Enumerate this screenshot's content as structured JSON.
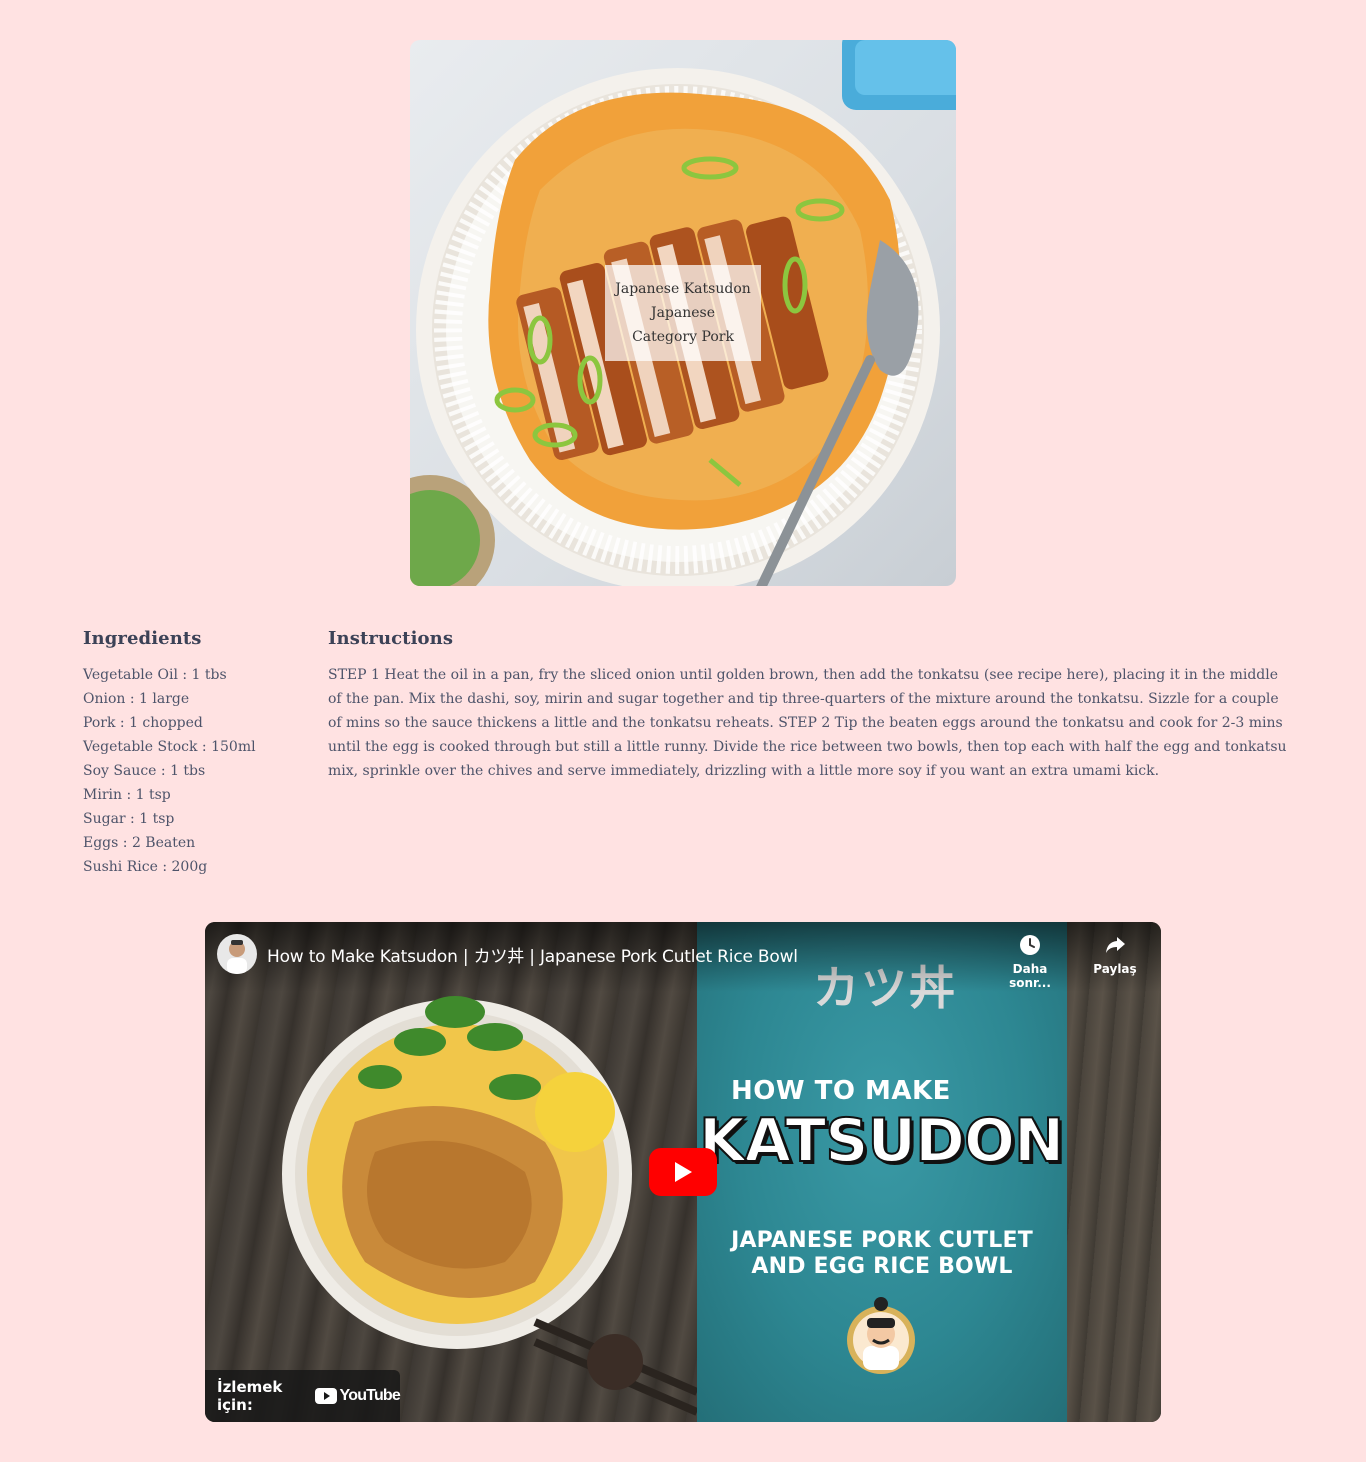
{
  "meal": {
    "name": "Japanese Katsudon",
    "area": "Japanese",
    "category_line": "Category Pork"
  },
  "ingredients": {
    "heading": "Ingredients",
    "items": [
      "Vegetable Oil : 1 tbs",
      "Onion : 1 large",
      "Pork : 1 chopped",
      "Vegetable Stock : 150ml",
      "Soy Sauce : 1 tbs",
      "Mirin : 1 tsp",
      "Sugar : 1 tsp",
      "Eggs : 2 Beaten",
      "Sushi Rice : 200g"
    ]
  },
  "instructions": {
    "heading": "Instructions",
    "text": "STEP 1 Heat the oil in a pan, fry the sliced onion until golden brown, then add the tonkatsu (see recipe here), placing it in the middle of the pan. Mix the dashi, soy, mirin and sugar together and tip three-quarters of the mixture around the tonkatsu. Sizzle for a couple of mins so the sauce thickens a little and the tonkatsu reheats. STEP 2 Tip the beaten eggs around the tonkatsu and cook for 2-3 mins until the egg is cooked through but still a little runny. Divide the rice between two bowls, then top each with half the egg and tonkatsu mix, sprinkle over the chives and serve immediately, drizzling with a little more soy if you want an extra umami kick."
  },
  "video": {
    "title": "How to Make Katsudon | カツ丼 | Japanese Pork Cutlet Rice Bowl",
    "watch_later_label": "Daha sonr...",
    "share_label": "Paylaş",
    "watch_on_label": "İzlemek için:",
    "youtube_label": "YouTube",
    "thumbnail": {
      "kanji": "カツ丼",
      "line1": "HOW TO MAKE",
      "line2": "KATSUDON",
      "line3": "JAPANESE PORK CUTLET",
      "line4": "AND EGG RICE BOWL"
    },
    "play_color": "#ff0000"
  },
  "colors": {
    "page_background": "#ffe2e2",
    "text": "#4e546a",
    "heading": "#3c4257"
  }
}
